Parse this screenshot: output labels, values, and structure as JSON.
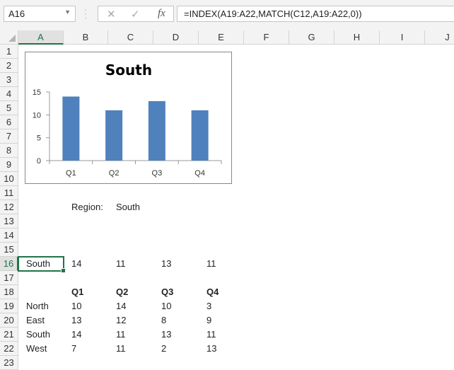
{
  "name_box": "A16",
  "formula": "=INDEX(A19:A22,MATCH(C12,A19:A22,0))",
  "icons": {
    "cancel": "✕",
    "enter": "✓",
    "fx": "fx"
  },
  "columns": [
    "A",
    "B",
    "C",
    "D",
    "E",
    "F",
    "G",
    "H",
    "I",
    "J"
  ],
  "selected_column": "A",
  "selected_row": 16,
  "rows": [
    "1",
    "2",
    "3",
    "4",
    "5",
    "6",
    "7",
    "8",
    "9",
    "10",
    "11",
    "12",
    "13",
    "14",
    "15",
    "16",
    "17",
    "18",
    "19",
    "20",
    "21",
    "22",
    "23"
  ],
  "cells": {
    "B12": "Region:",
    "C12": "South",
    "A16": "South",
    "B16": "14",
    "C16": "11",
    "D16": "13",
    "E16": "11",
    "B18": "Q1",
    "C18": "Q2",
    "D18": "Q3",
    "E18": "Q4",
    "A19": "North",
    "B19": "10",
    "C19": "14",
    "D19": "10",
    "E19": "3",
    "A20": "East",
    "B20": "13",
    "C20": "12",
    "D20": "8",
    "E20": "9",
    "A21": "South",
    "B21": "14",
    "C21": "11",
    "D21": "13",
    "E21": "11",
    "A22": "West",
    "B22": "7",
    "C22": "11",
    "D22": "2",
    "E22": "13"
  },
  "chart_data": {
    "type": "bar",
    "title": "South",
    "categories": [
      "Q1",
      "Q2",
      "Q3",
      "Q4"
    ],
    "values": [
      14,
      11,
      13,
      11
    ],
    "yticks": [
      "0",
      "5",
      "10",
      "15"
    ],
    "ylim": [
      0,
      15
    ],
    "grid": false,
    "bar_color": "#4f81bd"
  },
  "colors": {
    "accent": "#217346"
  }
}
